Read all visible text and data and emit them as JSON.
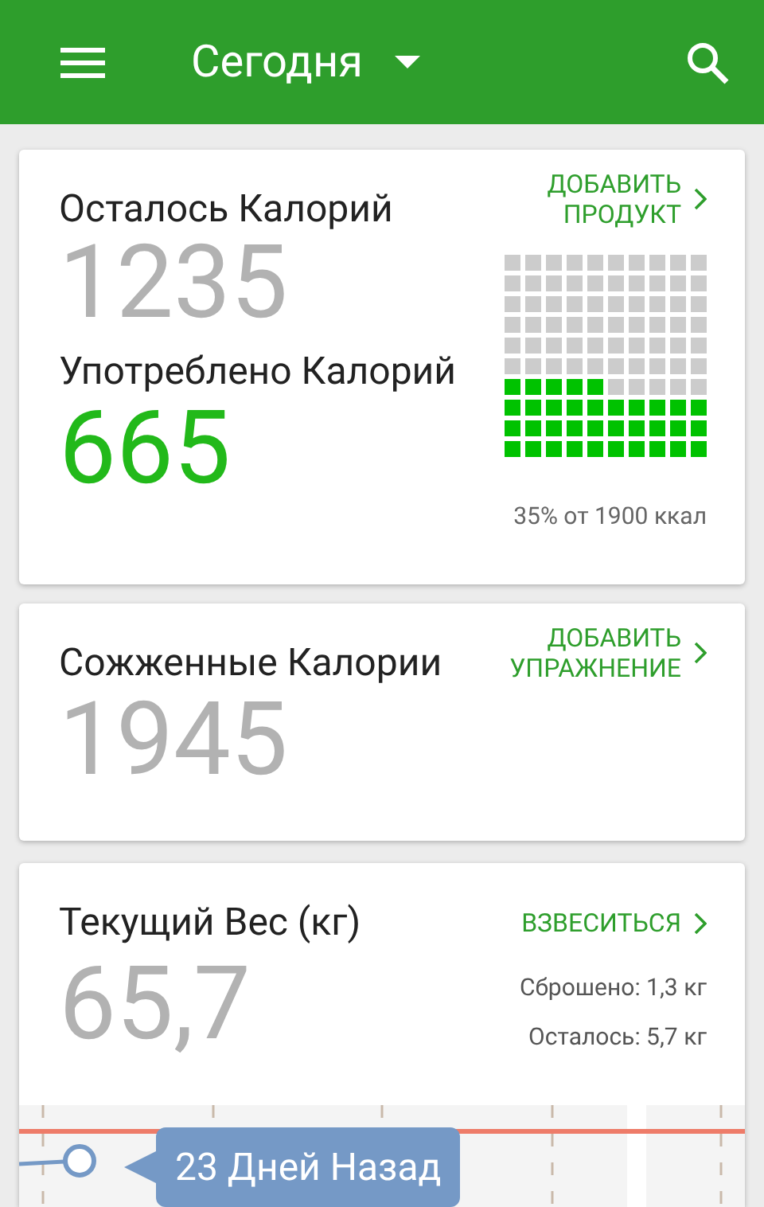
{
  "header": {
    "title": "Сегодня"
  },
  "remaining": {
    "label": "Осталось Калорий",
    "value": "1235",
    "action": [
      "ДОБАВИТЬ",
      "ПРОДУКТ"
    ]
  },
  "consumed": {
    "label": "Употреблено Калорий",
    "value": "665",
    "grid_rows": [
      [
        false,
        false,
        false,
        false,
        false,
        false,
        false,
        false,
        false,
        false
      ],
      [
        false,
        false,
        false,
        false,
        false,
        false,
        false,
        false,
        false,
        false
      ],
      [
        false,
        false,
        false,
        false,
        false,
        false,
        false,
        false,
        false,
        false
      ],
      [
        false,
        false,
        false,
        false,
        false,
        false,
        false,
        false,
        false,
        false
      ],
      [
        false,
        false,
        false,
        false,
        false,
        false,
        false,
        false,
        false,
        false
      ],
      [
        false,
        false,
        false,
        false,
        false,
        false,
        false,
        false,
        false,
        false
      ],
      [
        true,
        true,
        true,
        true,
        true,
        false,
        false,
        false,
        false,
        false
      ],
      [
        true,
        true,
        true,
        true,
        true,
        true,
        true,
        true,
        true,
        true
      ],
      [
        true,
        true,
        true,
        true,
        true,
        true,
        true,
        true,
        true,
        true
      ],
      [
        true,
        true,
        true,
        true,
        true,
        true,
        true,
        true,
        true,
        true
      ]
    ],
    "caption": "35% от 1900 ккал"
  },
  "burned": {
    "label": "Сожженные Калории",
    "value": "1945",
    "action": [
      "ДОБАВИТЬ",
      "УПРАЖНЕНИЕ"
    ]
  },
  "weight": {
    "label": "Текущий Вес (кг)",
    "value": "65,7",
    "action": "ВЗВЕСИТЬСЯ",
    "lost": "Сброшено: 1,3 кг",
    "left": "Осталось: 5,7 кг",
    "tooltip": "23 Дней Назад"
  }
}
